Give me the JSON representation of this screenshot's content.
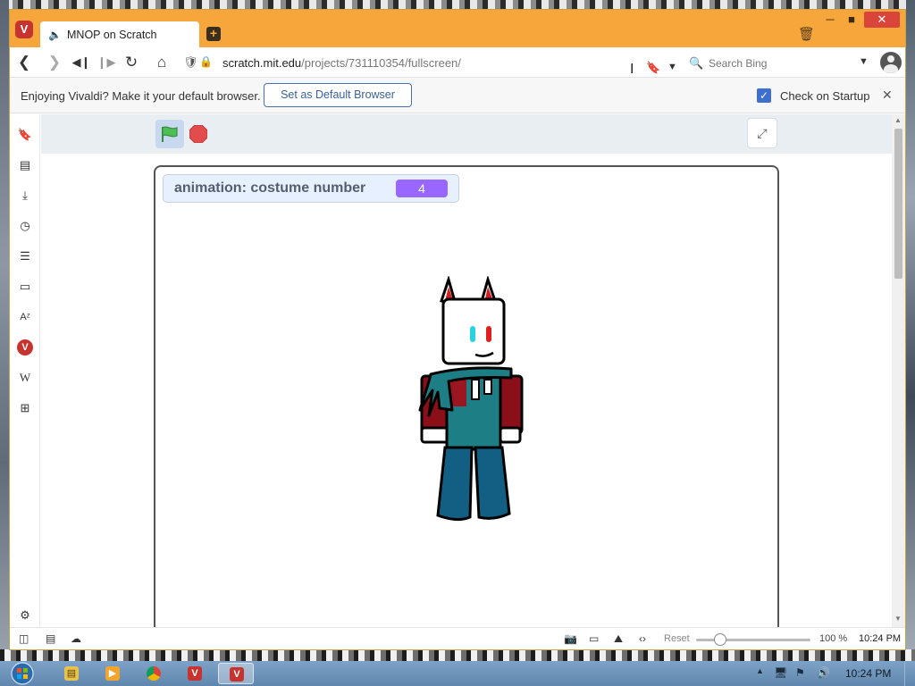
{
  "browser": {
    "tab": {
      "title": "MNOP on Scratch"
    },
    "url": {
      "domain": "scratch.mit.edu",
      "path": "/projects/731110354/fullscreen/"
    },
    "search": {
      "placeholder": "Search Bing"
    },
    "notification": {
      "message": "Enjoying Vivaldi? Make it your default browser.",
      "set_default_label": "Set as Default Browser",
      "check_label": "Check on Startup",
      "checked": true
    },
    "status": {
      "reset_label": "Reset",
      "zoom": "100 %",
      "time": "10:24 PM"
    }
  },
  "scratch": {
    "monitor": {
      "label": "animation: costume number",
      "value": "4"
    }
  },
  "taskbar": {
    "clock": "10:24 PM"
  },
  "colors": {
    "vivaldi_orange": "#f6a63a",
    "vivaldi_red": "#c7332f",
    "scratch_monitor_value": "#9966ff",
    "scratch_flag": "#4cbf56",
    "scratch_stop": "#e24c4c"
  },
  "icons": {
    "sidebar": [
      "bookmark-icon",
      "reading-list-icon",
      "download-icon",
      "history-icon",
      "notes-icon",
      "window-panel-icon",
      "translate-icon",
      "vivaldi-icon",
      "wikipedia-icon",
      "add-panel-icon",
      "settings-icon"
    ]
  }
}
